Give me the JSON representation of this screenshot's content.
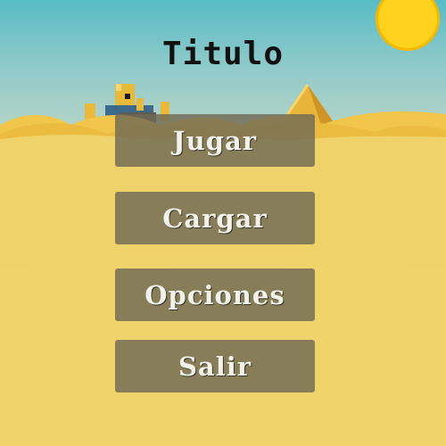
{
  "title": "Titulo",
  "menu": {
    "play_label": "Jugar",
    "load_label": "Cargar",
    "options_label": "Opciones",
    "quit_label": "Salir"
  },
  "colors": {
    "sky": "#58bcc6",
    "sand": "#efd36a",
    "sun": "#ffd21e",
    "button_bg": "#706a56",
    "button_text": "#f2f2ea"
  },
  "icons": [
    "sun-icon",
    "pyramid-icon",
    "sand-castle-icon"
  ]
}
